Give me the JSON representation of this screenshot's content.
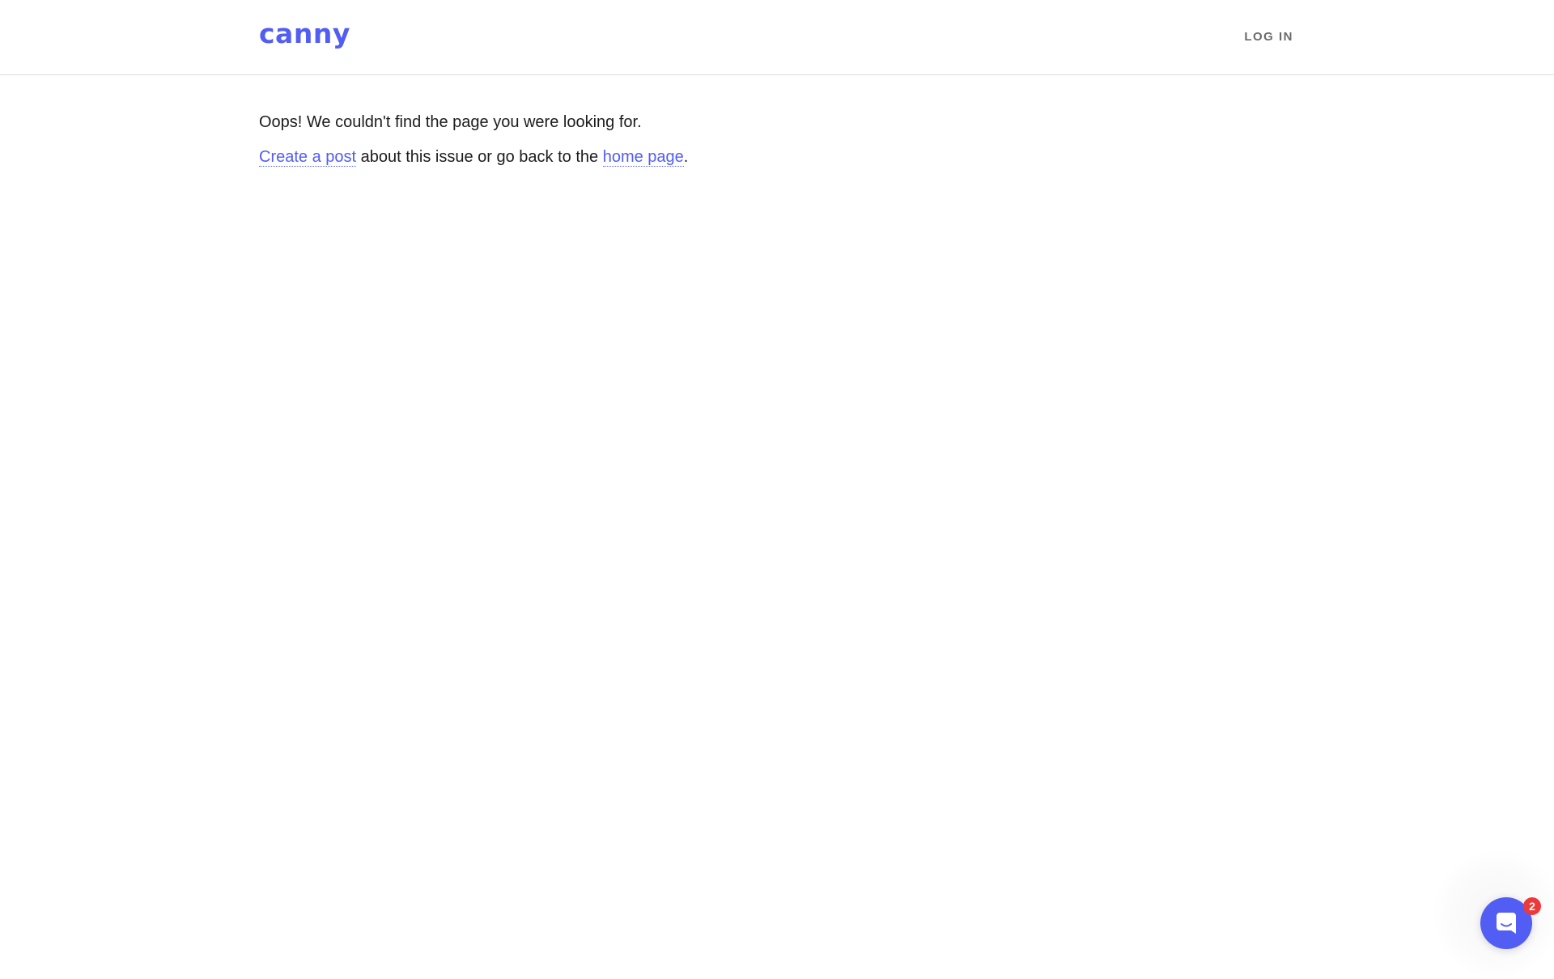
{
  "header": {
    "logo_text": "canny",
    "login_label": "LOG IN"
  },
  "content": {
    "message": "Oops! We couldn't find the page you were looking for.",
    "create_post_link": "Create a post",
    "middle_text": " about this issue or go back to the ",
    "home_page_link": "home page",
    "end_text": "."
  },
  "messenger": {
    "icon": "chat-icon",
    "badge_count": "2"
  },
  "colors": {
    "brand": "#525df4",
    "badge": "#ec3a3a",
    "text": "#1c1c1c",
    "muted": "#6b6b6b"
  }
}
